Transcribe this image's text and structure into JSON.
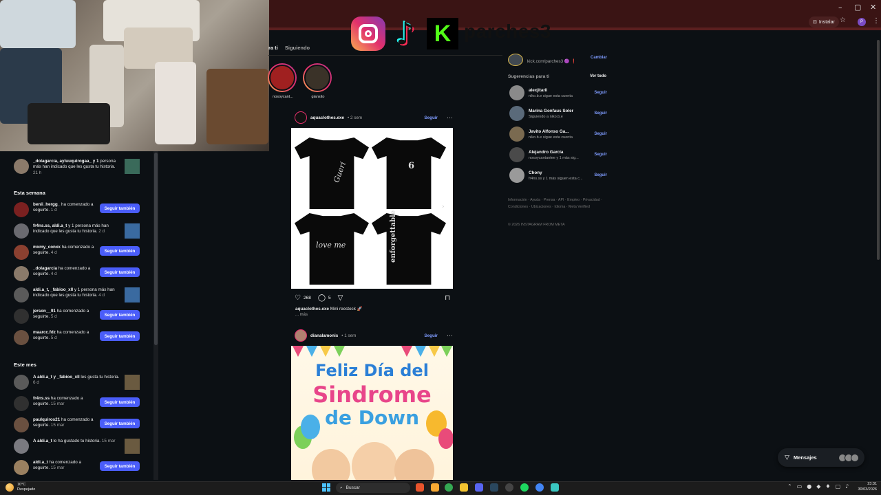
{
  "browser": {
    "install_label": "Instalar",
    "window_buttons": [
      "–",
      "▢",
      "✕"
    ],
    "profile_initial": "P"
  },
  "overlay": {
    "channel_name": "parches3",
    "kick_letter": "K"
  },
  "notifications": {
    "top_item": {
      "text_bold": "_dolagarcia, ayluuquirogaa_ y 1",
      "text": "persona más han indicado que les gusta tu historia.",
      "time": "21 h"
    },
    "section_week": "Esta semana",
    "week_items": [
      {
        "user": "benii_hergg_",
        "text": "ha comenzado a seguirte.",
        "time": "1 d",
        "button": "Seguir también"
      },
      {
        "user": "fr4ns.ss, aldi.a_t",
        "text": "y 1 persona más han indicado que les gusta tu historia.",
        "time": "2 d"
      },
      {
        "user": "mxmy_conxx",
        "text": "ha comenzado a seguirte.",
        "time": "4 d",
        "button": "Seguir también"
      },
      {
        "user": "_dolagarcia",
        "text": "ha comenzado a seguirte.",
        "time": "4 d",
        "button": "Seguir también"
      },
      {
        "user": "aldi.a_t, _fabioo_xll",
        "text": "y 1 persona más han indicado que les gusta tu historia.",
        "time": "4 d"
      },
      {
        "user": "jerson__91",
        "text": "ha comenzado a seguirte.",
        "time": "5 d",
        "button": "Seguir también"
      },
      {
        "user": "maarcc.fdz",
        "text": "ha comenzado a seguirte.",
        "time": "5 d",
        "button": "Seguir también"
      }
    ],
    "section_month": "Este mes",
    "month_items": [
      {
        "user": "A aldi.a_t y _fabioo_xll",
        "text": "les gusta tu historia.",
        "time": "6 d"
      },
      {
        "user": "fr4ns.ss",
        "text": "ha comenzado a seguirte.",
        "time": "15 mar",
        "button": "Seguir también"
      },
      {
        "user": "paulquiros21",
        "text": "ha comenzado a seguirte.",
        "time": "15 mar",
        "button": "Seguir también"
      },
      {
        "user": "A aldi.a_t",
        "text": "le ha gustado tu historia.",
        "time": "15 mar"
      },
      {
        "user": "aldi.a_t",
        "text": "ha comenzado a seguirte.",
        "time": "15 mar",
        "button": "Seguir también"
      }
    ]
  },
  "feed": {
    "tab_for_you": "ra ti",
    "tab_following": "Siguiendo",
    "stories": [
      {
        "label": "nosoycant..."
      },
      {
        "label": "giansito"
      }
    ],
    "post1": {
      "user": "aquaclothes.exe",
      "time": "• 2 sem",
      "follow": "Seguir",
      "likes": "268",
      "comments": "5",
      "caption_user": "aquaclothes.exe",
      "caption_text": "Mini reestock 🚀",
      "more": "... más",
      "shirt_texts": [
        "Gueri",
        "6",
        "love me",
        "enforgettable"
      ]
    },
    "post2": {
      "user": "dianalamonis",
      "time": "• 1 sem",
      "follow": "Seguir",
      "image_lines": [
        "Feliz Día del",
        "Sindrome",
        "de Down"
      ]
    }
  },
  "sidebar": {
    "self_link": "kick.com/parches3 🟣 ❗",
    "switch": "Cambiar",
    "suggestions_title": "Sugerencias para ti",
    "see_all": "Ver todo",
    "suggestions": [
      {
        "name": "alexjitarii",
        "sub": "niko.b.e sigue esta cuenta",
        "follow": "Seguir"
      },
      {
        "name": "Marina Gonfaus Soler",
        "sub": "Siguiendo a niko.b.e",
        "follow": "Seguir"
      },
      {
        "name": "Javito Alfonso Ga...",
        "sub": "niko.b.e sigue esta cuenta",
        "follow": "Seguir"
      },
      {
        "name": "Alejandro Garcia",
        "sub": "nosoycantantee y 1 más sig...",
        "follow": "Seguir"
      },
      {
        "name": "Chony",
        "sub": "fr4ns.ss y 1 más siguen esta c...",
        "follow": "Seguir"
      }
    ],
    "footer_links": "Información · Ayuda · Prensa · API · Empleo · Privacidad · Condiciones · Ubicaciones · Idioma · Meta Verified",
    "copyright": "© 2026 INSTAGRAM FROM META"
  },
  "messages": {
    "label": "Mensajes"
  },
  "taskbar": {
    "temperature": "10°C",
    "weather": "Despejado",
    "search_placeholder": "Buscar",
    "time": "23:31",
    "date": "30/03/2026"
  },
  "colors": {
    "accent_blue": "#4a5df9",
    "link_blue": "#7f9cff",
    "background": "#0c1014",
    "chrome_red": "#3a1414"
  }
}
